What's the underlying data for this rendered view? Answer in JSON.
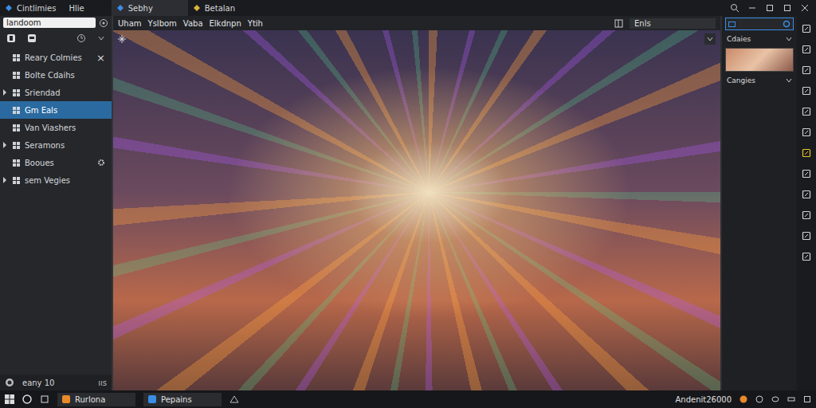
{
  "window": {
    "tabs": [
      {
        "label": "Cintlimies",
        "selected": false,
        "icon": true
      },
      {
        "label": "Hlie",
        "selected": false,
        "icon": false
      },
      {
        "label": "Sebhy",
        "selected": true,
        "icon": true
      },
      {
        "label": "Betalan",
        "selected": false,
        "icon": true
      }
    ]
  },
  "sidebar": {
    "search": "landoom",
    "items": [
      {
        "label": "Reary Colmies",
        "selected": false,
        "expandable": false,
        "trail": "×",
        "settings": false
      },
      {
        "label": "Bolte Cdaihs",
        "selected": false,
        "expandable": false,
        "trail": "",
        "settings": false
      },
      {
        "label": "Sriendad",
        "selected": false,
        "expandable": true,
        "trail": "",
        "settings": false
      },
      {
        "label": "Gm Eals",
        "selected": true,
        "expandable": false,
        "trail": "",
        "settings": false
      },
      {
        "label": "Van Viashers",
        "selected": false,
        "expandable": false,
        "trail": "",
        "settings": false
      },
      {
        "label": "Seramons",
        "selected": false,
        "expandable": true,
        "trail": "",
        "settings": false
      },
      {
        "label": "Booues",
        "selected": false,
        "expandable": false,
        "trail": "",
        "settings": true
      },
      {
        "label": "sem Vegies",
        "selected": false,
        "expandable": true,
        "trail": "",
        "settings": false
      }
    ],
    "footer": {
      "label": "eany 10",
      "extra": "ııs"
    }
  },
  "menu": [
    "Uham",
    "Yslbom",
    "Vaba",
    "Elkdnpn",
    "Ytih"
  ],
  "top_field": {
    "value": "Enls"
  },
  "right_panel": {
    "sections": [
      {
        "title": "Cdaies",
        "has_thumbnail": true
      },
      {
        "title": "Cangies",
        "has_thumbnail": false
      }
    ]
  },
  "tools": [
    {
      "selected": false
    },
    {
      "selected": false
    },
    {
      "selected": false
    },
    {
      "selected": false
    },
    {
      "selected": false
    },
    {
      "selected": false
    },
    {
      "selected": true
    },
    {
      "selected": false
    },
    {
      "selected": false
    },
    {
      "selected": false
    },
    {
      "selected": false
    },
    {
      "selected": false
    }
  ],
  "taskbar": {
    "apps": [
      {
        "label": "Rurlona",
        "color": "#e8892b"
      },
      {
        "label": "Pepains",
        "color": "#3a8ee6"
      }
    ],
    "clock": "Andenit26000"
  }
}
